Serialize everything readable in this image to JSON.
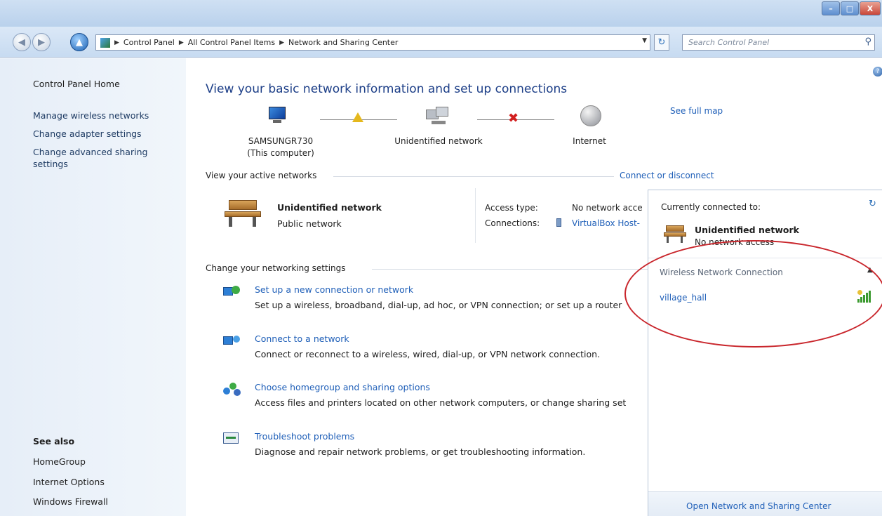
{
  "window": {
    "controls": {
      "minimize": "–",
      "maximize": "□",
      "close": "X"
    }
  },
  "nav": {
    "back_icon": "back-arrow-icon",
    "up_icon": "up-arrow-icon",
    "breadcrumb": [
      "Control Panel",
      "All Control Panel Items",
      "Network and Sharing Center"
    ],
    "search_placeholder": "Search Control Panel"
  },
  "left_pane": {
    "home": "Control Panel Home",
    "links": [
      "Manage wireless networks",
      "Change adapter settings",
      "Change advanced sharing",
      "settings"
    ],
    "see_also_title": "See also",
    "see_also": [
      "HomeGroup",
      "Internet Options",
      "Windows Firewall"
    ]
  },
  "main": {
    "title": "View your basic network information and set up connections",
    "see_full_map": "See full map",
    "map": {
      "computer_name": "SAMSUNGR730",
      "computer_sub": "(This computer)",
      "network_name": "Unidentified network",
      "internet": "Internet"
    },
    "active_networks": {
      "heading": "View your active networks",
      "connect_link": "Connect or disconnect",
      "name": "Unidentified network",
      "type": "Public network",
      "access_label": "Access type:",
      "access_value": "No network acce",
      "connections_label": "Connections:",
      "connections_value": "VirtualBox Host-"
    },
    "change_settings": {
      "heading": "Change your networking settings",
      "tasks": [
        {
          "icon": "new-connection-icon",
          "link": "Set up a new connection or network",
          "desc": "Set up a wireless, broadband, dial-up, ad hoc, or VPN connection; or set up a router"
        },
        {
          "icon": "connect-network-icon",
          "link": "Connect to a network",
          "desc": "Connect or reconnect to a wireless, wired, dial-up, or VPN network connection."
        },
        {
          "icon": "homegroup-icon",
          "link": "Choose homegroup and sharing options",
          "desc": "Access files and printers located on other network computers, or change sharing set"
        },
        {
          "icon": "troubleshoot-icon",
          "link": "Troubleshoot problems",
          "desc": "Diagnose and repair network problems, or get troubleshooting information."
        }
      ]
    }
  },
  "flyout": {
    "currently_connected": "Currently connected to:",
    "network_name": "Unidentified network",
    "network_status": "No network access",
    "section": "Wireless Network Connection",
    "wifi_name": "village_hall",
    "footer_link": "Open Network and Sharing Center"
  },
  "colors": {
    "link": "#1f5fb8",
    "title": "#1c3e87",
    "annotation": "#c9262c"
  }
}
